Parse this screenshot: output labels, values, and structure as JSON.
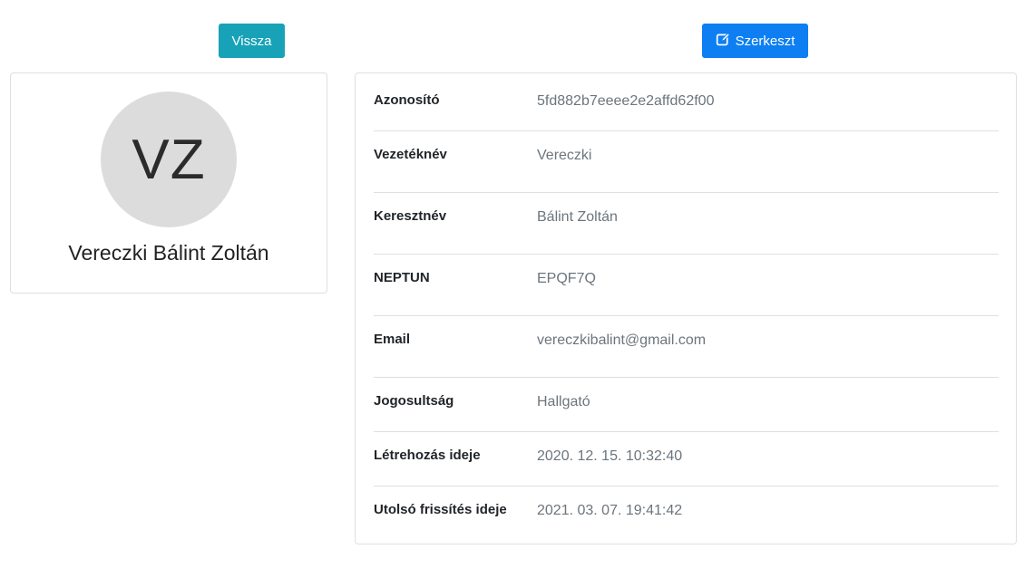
{
  "actions": {
    "back_label": "Vissza",
    "edit_label": "Szerkeszt",
    "edit_icon": "edit-icon"
  },
  "profile": {
    "initials": "VZ",
    "full_name": "Vereczki Bálint Zoltán"
  },
  "details": [
    {
      "label": "Azonosító",
      "value": "5fd882b7eeee2e2affd62f00"
    },
    {
      "label": "Vezetéknév",
      "value": "Vereczki"
    },
    {
      "label": "Keresztnév",
      "value": "Bálint Zoltán"
    },
    {
      "label": "NEPTUN",
      "value": "EPQF7Q"
    },
    {
      "label": "Email",
      "value": "vereczkibalint@gmail.com"
    },
    {
      "label": "Jogosultság",
      "value": "Hallgató"
    },
    {
      "label": "Létrehozás ideje",
      "value": "2020. 12. 15. 10:32:40"
    },
    {
      "label": "Utolsó frissítés ideje",
      "value": "2021. 03. 07. 19:41:42"
    }
  ],
  "colors": {
    "back_button": "#17a2b8",
    "edit_button": "#0d7ff2",
    "avatar_bg": "#dcdcdc"
  }
}
